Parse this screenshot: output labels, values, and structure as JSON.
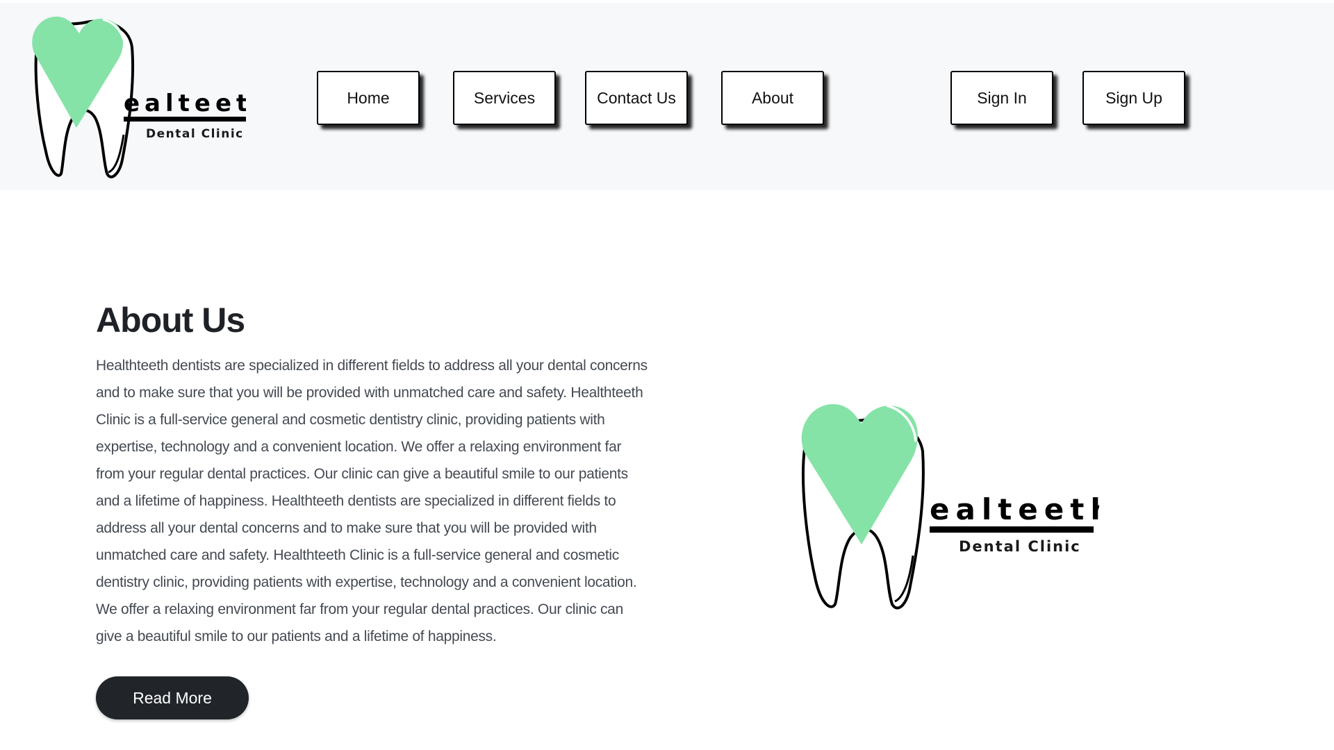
{
  "brand": {
    "logo_name": "ealteeth",
    "logo_subtitle": "Dental Clinic",
    "heart_color": "#86e3a8"
  },
  "nav": {
    "items": [
      {
        "label": "Home"
      },
      {
        "label": "Services"
      },
      {
        "label": "Contact Us"
      },
      {
        "label": "About"
      }
    ],
    "auth": {
      "sign_in": "Sign In",
      "sign_up": "Sign Up"
    }
  },
  "about": {
    "title": "About Us",
    "body": "Healthteeth dentists are specialized in different fields to address all your dental concerns and to make sure that you will be provided with unmatched care and safety. Healthteeth Clinic is a full-service general and cosmetic dentistry clinic, providing patients with expertise, technology and a convenient location. We offer a relaxing environment far from your regular dental practices. Our clinic can give a beautiful smile to our patients and a lifetime of happiness. Healthteeth dentists are specialized in different fields to address all your dental concerns and to make sure that you will be provided with unmatched care and safety. Healthteeth Clinic is a full-service general and cosmetic dentistry clinic, providing patients with expertise, technology and a convenient location. We offer a relaxing environment far from your regular dental practices. Our clinic can give a beautiful smile to our patients and a lifetime of happiness.",
    "read_more": "Read More"
  }
}
